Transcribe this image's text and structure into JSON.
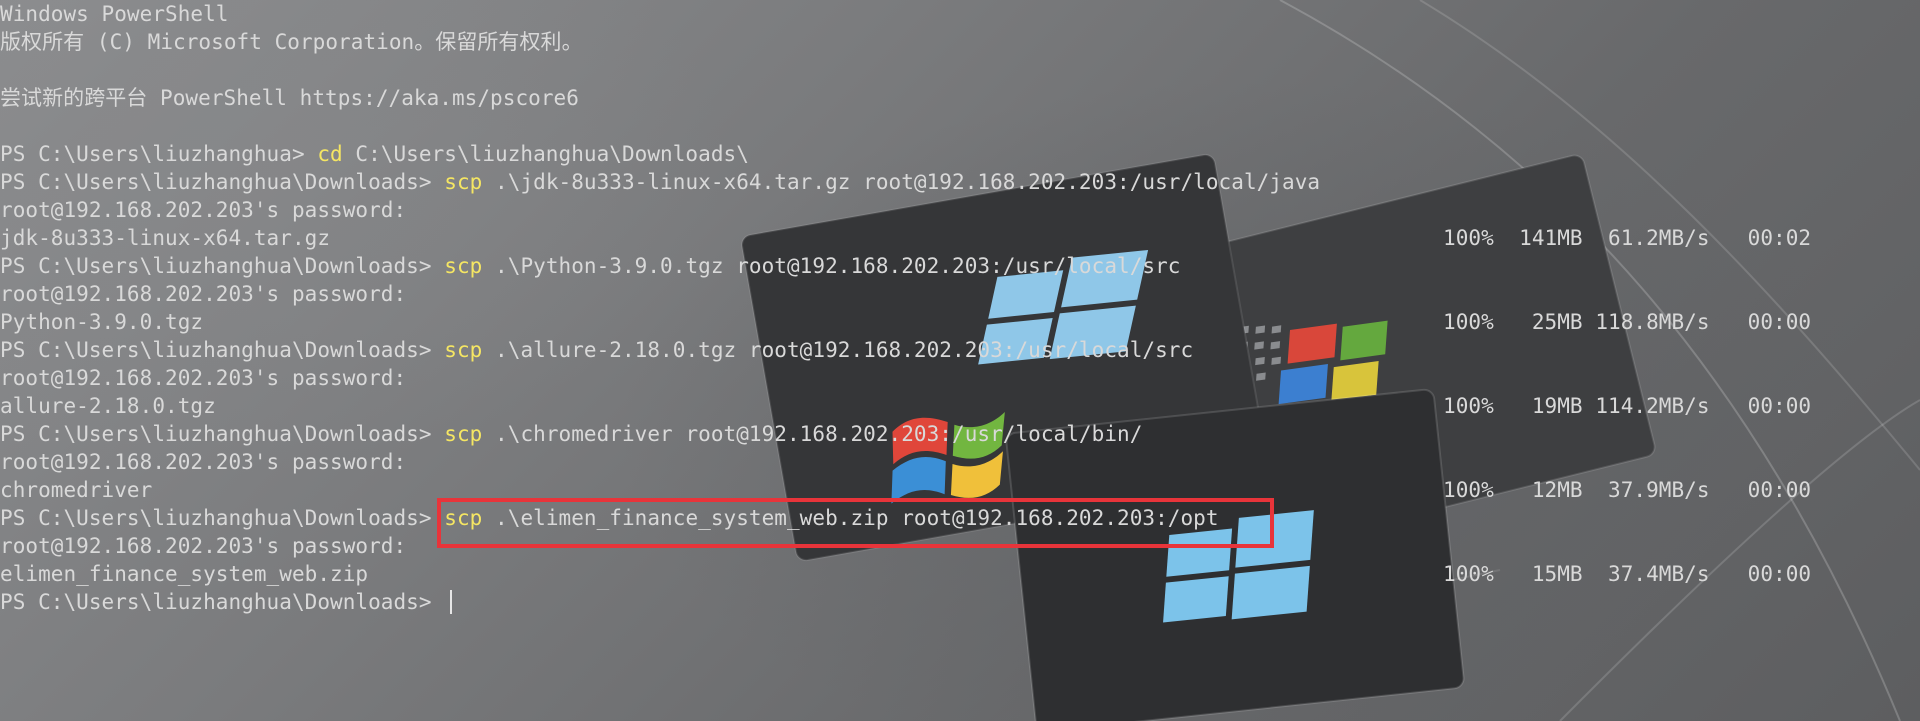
{
  "colors": {
    "background": "#7a7b7d",
    "text": "#d9d9d9",
    "command": "#f5e663",
    "highlight_box": "#e8343a"
  },
  "terminal": {
    "header": {
      "title": "Windows PowerShell",
      "copyright": "版权所有 (C) Microsoft Corporation。保留所有权利。",
      "tip": "尝试新的跨平台 PowerShell https://aka.ms/pscore6"
    },
    "sessions": [
      {
        "prompt": "PS C:\\Users\\liuzhanghua> ",
        "command": "cd",
        "args": " C:\\Users\\liuzhanghua\\Downloads\\"
      },
      {
        "prompt": "PS C:\\Users\\liuzhanghua\\Downloads> ",
        "command": "scp",
        "args": " .\\jdk-8u333-linux-x64.tar.gz root@192.168.202.203:/usr/local/java",
        "password_prompt": "root@192.168.202.203's password:",
        "file": "jdk-8u333-linux-x64.tar.gz",
        "stats": "100%  141MB  61.2MB/s   00:02"
      },
      {
        "prompt": "PS C:\\Users\\liuzhanghua\\Downloads> ",
        "command": "scp",
        "args": " .\\Python-3.9.0.tgz root@192.168.202.203:/usr/local/src",
        "password_prompt": "root@192.168.202.203's password:",
        "file": "Python-3.9.0.tgz",
        "stats": "100%   25MB 118.8MB/s   00:00"
      },
      {
        "prompt": "PS C:\\Users\\liuzhanghua\\Downloads> ",
        "command": "scp",
        "args": " .\\allure-2.18.0.tgz root@192.168.202.203:/usr/local/src",
        "password_prompt": "root@192.168.202.203's password:",
        "file": "allure-2.18.0.tgz",
        "stats": "100%   19MB 114.2MB/s   00:00"
      },
      {
        "prompt": "PS C:\\Users\\liuzhanghua\\Downloads> ",
        "command": "scp",
        "args": " .\\chromedriver root@192.168.202.203:/usr/local/bin/",
        "password_prompt": "root@192.168.202.203's password:",
        "file": "chromedriver",
        "stats": "100%   12MB  37.9MB/s   00:00"
      },
      {
        "prompt": "PS C:\\Users\\liuzhanghua\\Downloads> ",
        "command": "scp",
        "args": " .\\elimen_finance_system_web.zip root@192.168.202.203:/opt",
        "password_prompt": "root@192.168.202.203's password:",
        "file": "elimen_finance_system_web.zip",
        "stats": "100%   15MB  37.4MB/s   00:00"
      }
    ],
    "final_prompt": "PS C:\\Users\\liuzhanghua\\Downloads> "
  }
}
